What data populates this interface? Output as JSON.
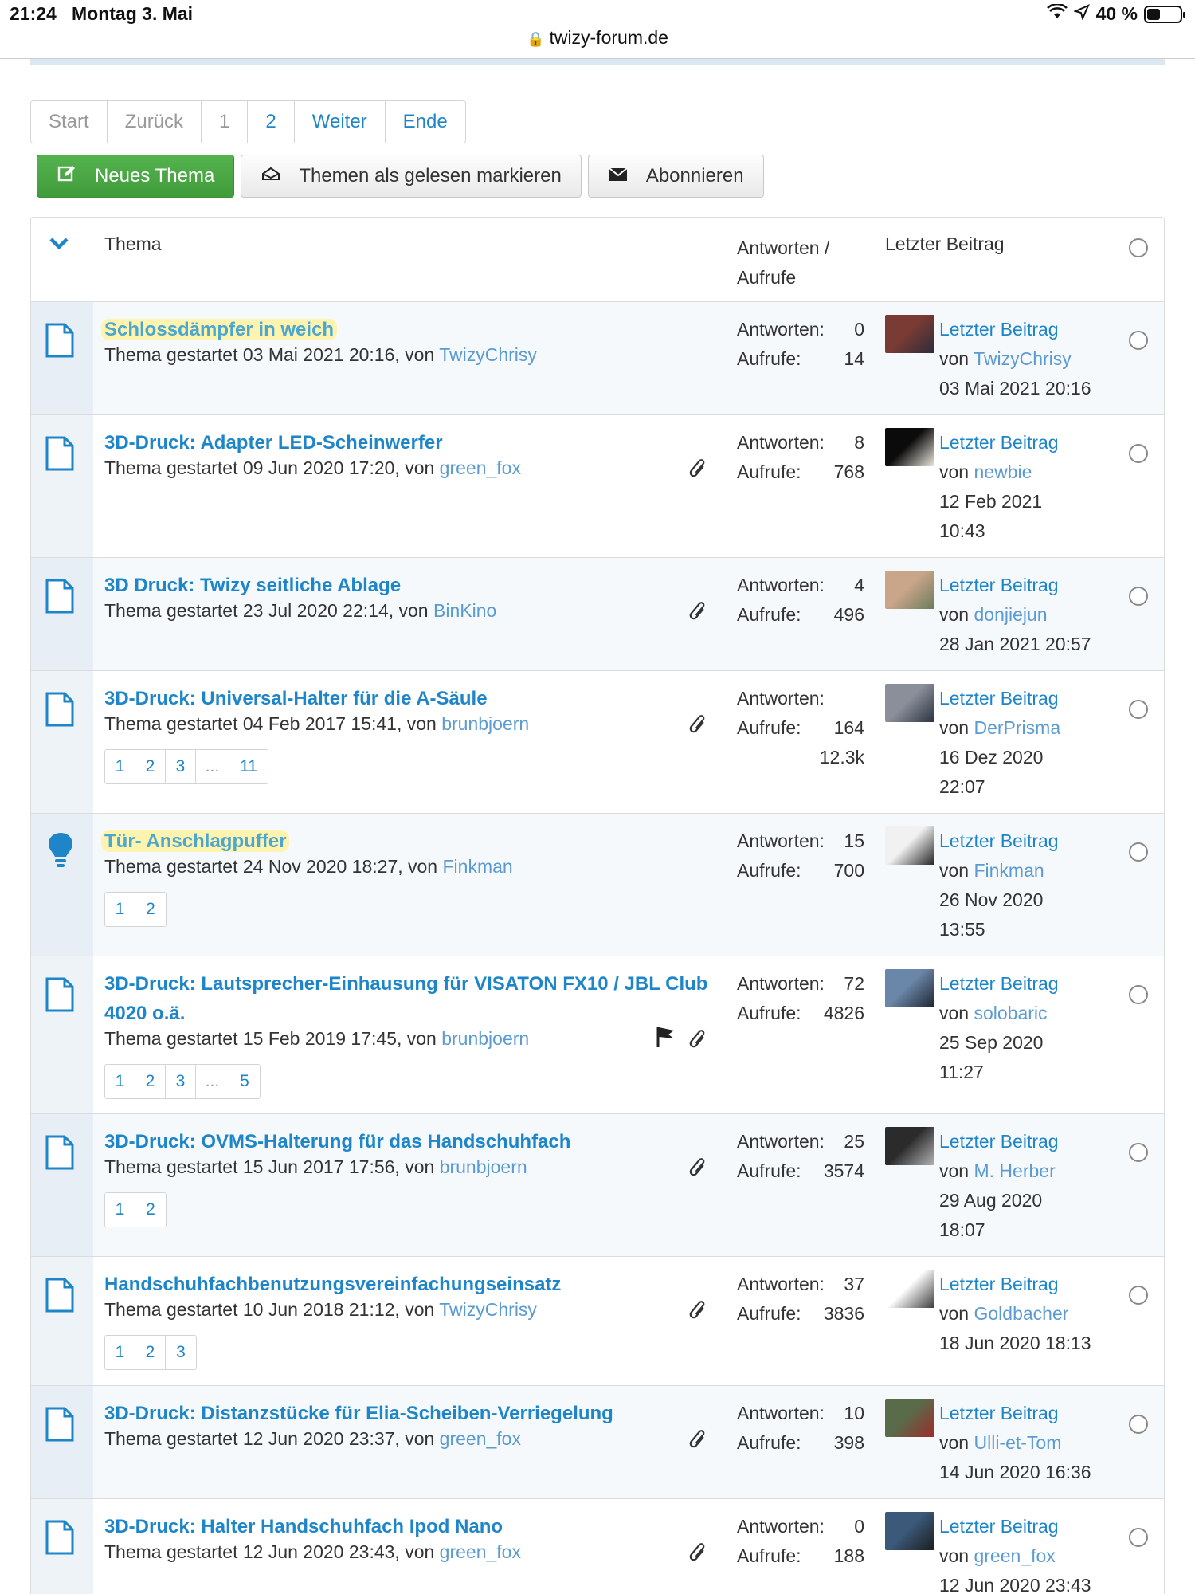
{
  "status_bar": {
    "time": "21:24",
    "date": "Montag 3. Mai",
    "battery": "40 %",
    "battery_level": 0.4
  },
  "browser": {
    "url": "twizy-forum.de"
  },
  "pagination": {
    "start": "Start",
    "back": "Zurück",
    "page1": "1",
    "page2": "2",
    "next": "Weiter",
    "end": "Ende"
  },
  "actions": {
    "new_topic": "Neues Thema",
    "mark_read": "Themen als gelesen markieren",
    "subscribe": "Abonnieren"
  },
  "header": {
    "topic": "Thema",
    "stats_1": "Antworten /",
    "stats_2": "Aufrufe",
    "last_post": "Letzter Beitrag"
  },
  "labels": {
    "replies": "Antworten:",
    "views": "Aufrufe:",
    "last_post": "Letzter Beitrag",
    "by": "von"
  },
  "topics": [
    {
      "title": "Schlossdämpfer in weich",
      "highlighted": true,
      "icon": "document-icon",
      "started_prefix": "Thema gestartet 03 Mai 2021 20:16, von ",
      "starter": "TwizyChrisy",
      "replies": "0",
      "views": "14",
      "last_user": "TwizyChrisy",
      "last_date": "03 Mai 2021 20:16",
      "attachment": false,
      "pages": []
    },
    {
      "title": "3D-Druck: Adapter LED-Scheinwerfer",
      "highlighted": false,
      "icon": "document-icon",
      "started_prefix": "Thema gestartet 09 Jun 2020 17:20, von ",
      "starter": "green_fox",
      "replies": "8",
      "views": "768",
      "last_user": "newbie",
      "last_date": "12 Feb 2021",
      "last_time": "10:43",
      "attachment": true,
      "pages": []
    },
    {
      "title": "3D Druck: Twizy seitliche Ablage",
      "highlighted": false,
      "icon": "document-icon",
      "started_prefix": "Thema gestartet 23 Jul 2020 22:14, von ",
      "starter": "BinKino",
      "replies": "4",
      "views": "496",
      "last_user": "donjiejun",
      "last_date": "28 Jan 2021 20:57",
      "attachment": true,
      "pages": []
    },
    {
      "title": "3D-Druck: Universal-Halter für die A-Säule",
      "highlighted": false,
      "icon": "document-icon",
      "started_prefix": "Thema gestartet 04 Feb 2017 15:41, von ",
      "starter": "brunbjoern",
      "replies": "",
      "views": "164",
      "extra": "12.3k",
      "last_user": "DerPrisma",
      "last_date": "16 Dez 2020",
      "last_time": "22:07",
      "attachment": true,
      "pages": [
        "1",
        "2",
        "3",
        "...",
        "11"
      ]
    },
    {
      "title": "Tür- Anschlagpuffer",
      "highlighted": true,
      "icon": "lightbulb-icon",
      "started_prefix": "Thema gestartet 24 Nov 2020 18:27, von ",
      "starter": "Finkman",
      "replies": "15",
      "views": "700",
      "last_user": "Finkman",
      "last_date": "26 Nov 2020",
      "last_time": "13:55",
      "attachment": false,
      "pages": [
        "1",
        "2"
      ]
    },
    {
      "title": "3D-Druck: Lautsprecher-Einhausung für VISATON FX10 / JBL Club 4020 o.ä.",
      "highlighted": false,
      "icon": "document-icon",
      "started_prefix": "Thema gestartet 15 Feb 2019 17:45, von ",
      "starter": "brunbjoern",
      "replies": "72",
      "views": "4826",
      "last_user": "solobaric",
      "last_date": "25 Sep 2020",
      "last_time": "11:27",
      "attachment": true,
      "flag": true,
      "pages": [
        "1",
        "2",
        "3",
        "...",
        "5"
      ]
    },
    {
      "title": "3D-Druck: OVMS-Halterung für das Handschuhfach",
      "highlighted": false,
      "icon": "document-icon",
      "started_prefix": "Thema gestartet 15 Jun 2017 17:56, von ",
      "starter": "brunbjoern",
      "replies": "25",
      "views": "3574",
      "last_user": "M. Herber",
      "last_date": "29 Aug 2020",
      "last_time": "18:07",
      "attachment": true,
      "pages": [
        "1",
        "2"
      ]
    },
    {
      "title": "Handschuhfachbenutzungsvereinfachungseinsatz",
      "highlighted": false,
      "icon": "document-icon",
      "started_prefix": "Thema gestartet 10 Jun 2018 21:12, von ",
      "starter": "TwizyChrisy",
      "replies": "37",
      "views": "3836",
      "last_user": "Goldbacher",
      "last_date": "18 Jun 2020 18:13",
      "attachment": true,
      "pages": [
        "1",
        "2",
        "3"
      ]
    },
    {
      "title": "3D-Druck: Distanzstücke für Elia-Scheiben-Verriegelung",
      "highlighted": false,
      "icon": "document-icon",
      "started_prefix": "Thema gestartet 12 Jun 2020 23:37, von ",
      "starter": "green_fox",
      "replies": "10",
      "views": "398",
      "last_user": "Ulli-et-Tom",
      "last_date": "14 Jun 2020 16:36",
      "attachment": true,
      "pages": []
    },
    {
      "title": "3D-Druck: Halter Handschuhfach Ipod Nano",
      "highlighted": false,
      "icon": "document-icon",
      "started_prefix": "Thema gestartet 12 Jun 2020 23:43, von ",
      "starter": "green_fox",
      "replies": "0",
      "views": "188",
      "last_user": "green_fox",
      "last_date": "12 Jun 2020 23:43",
      "attachment": true,
      "pages": []
    }
  ],
  "colors": {
    "link": "#1e86c8",
    "user": "#5b9bd1",
    "green_button": "#4caf50",
    "highlight": "#fff3b0"
  }
}
